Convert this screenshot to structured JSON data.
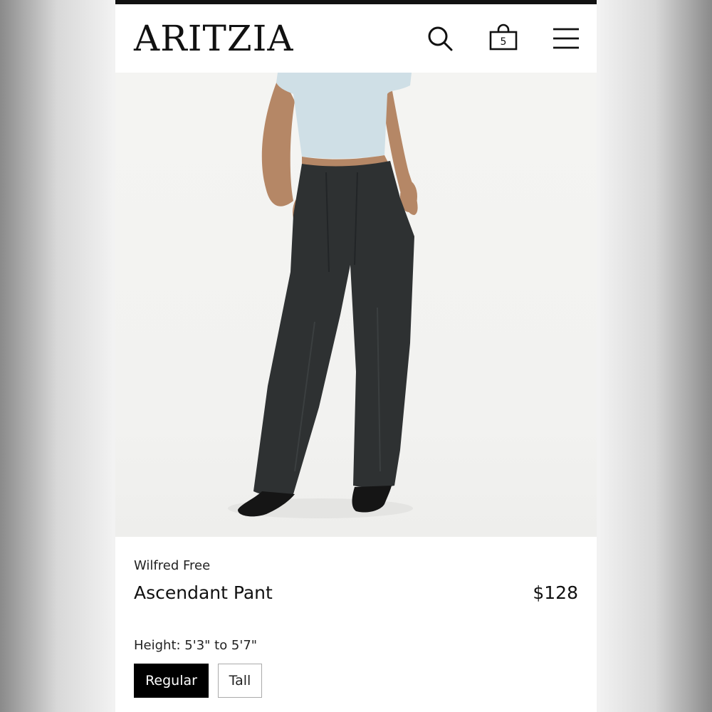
{
  "header": {
    "logo": "ARITZIA",
    "search_icon": "search-icon",
    "bag_icon": "shopping-bag-icon",
    "bag_count": "5",
    "menu_icon": "hamburger-menu-icon"
  },
  "product": {
    "image": "product-photo-model-wearing-black-wide-leg-pants",
    "brand": "Wilfred Free",
    "name": "Ascendant Pant",
    "price": "$128",
    "height_label": "Height: 5'3\" to 5'7\"",
    "fit_options": [
      {
        "label": "Regular",
        "selected": true
      },
      {
        "label": "Tall",
        "selected": false
      }
    ]
  },
  "colors": {
    "accent": "#000000",
    "background": "#ffffff"
  }
}
